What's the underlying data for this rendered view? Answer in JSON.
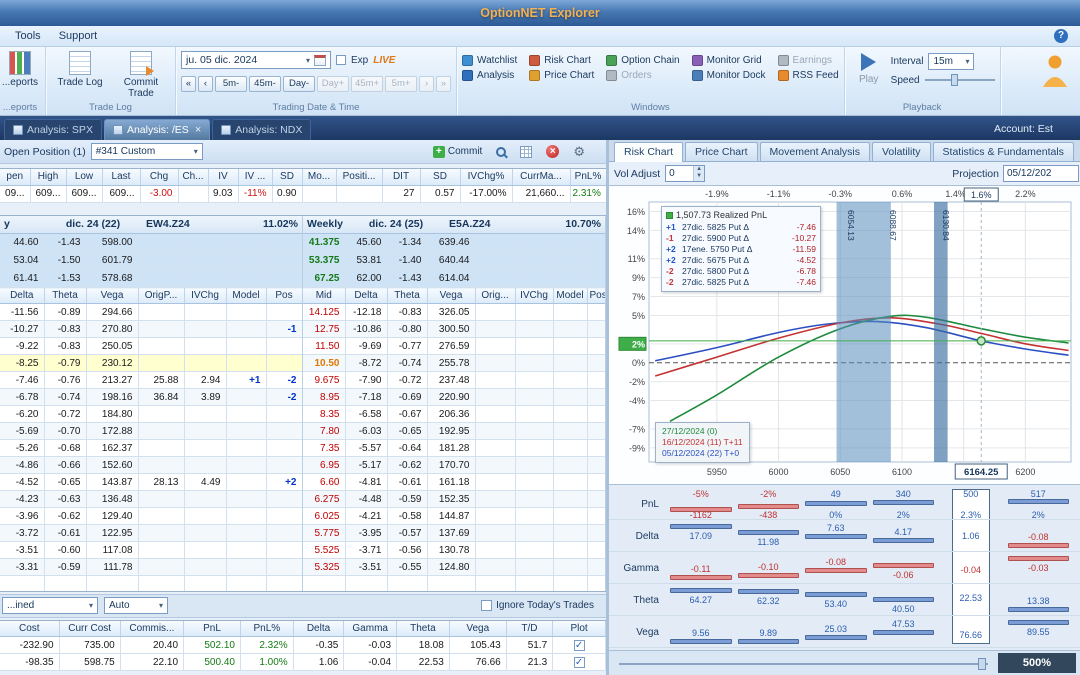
{
  "title": "OptionNET Explorer",
  "menu": {
    "tools": "Tools",
    "support": "Support",
    "help": "?"
  },
  "ribbon": {
    "reports": {
      "button": "...eports",
      "group": "...eports"
    },
    "tradelog": {
      "buttons": [
        "Trade Log",
        "Commit Trade"
      ],
      "label": "Trade Log"
    },
    "datetime": {
      "date": "ju. 05 dic. 2024",
      "exp": "Exp",
      "live": "LIVE",
      "back": [
        "5m-",
        "45m-",
        "Day-"
      ],
      "fwd": [
        "Day+",
        "45m+",
        "5m+"
      ],
      "label": "Trading Date & Time"
    },
    "windows": {
      "row1": [
        "Watchlist",
        "Risk Chart",
        "Option Chain",
        "Monitor Grid",
        "Earnings"
      ],
      "row2": [
        "Analysis",
        "Price Chart",
        "Orders",
        "Monitor Dock",
        "RSS Feed"
      ],
      "disabled": [
        "Earnings",
        "Orders"
      ],
      "label": "Windows"
    },
    "playback": {
      "play": "Play",
      "interval": "Interval",
      "interval_value": "15m",
      "speed": "Speed",
      "label": "Playback"
    }
  },
  "tabs": {
    "items": [
      "Analysis: SPX",
      "Analysis: /ES",
      "Analysis: NDX"
    ],
    "active": 1,
    "account": "Account: Est"
  },
  "position": {
    "label": "Open Position (1)",
    "selector": "#341 Custom",
    "commit": "Commit"
  },
  "quote": {
    "headers": [
      "pen",
      "High",
      "Low",
      "Last",
      "Chg",
      "Ch...",
      "IV",
      "IV ...",
      "SD",
      "Mo...",
      "Positi...",
      "DIT",
      "SD",
      "IVChg%",
      "CurrMa...",
      "PnL%"
    ],
    "values": [
      "09...",
      "609...",
      "609...",
      "609...",
      "-3.00",
      "",
      "9.03",
      "-11%",
      "0.90",
      "",
      "",
      "27",
      "0.57",
      "-17.00%",
      "21,660...",
      "2.31%"
    ]
  },
  "chains": {
    "left": {
      "title_prefix": "y",
      "expiry": "dic. 24 (22)",
      "code": "EW4.Z24",
      "iv": "11.02%",
      "columns": [
        "Delta",
        "Theta",
        "Vega",
        "OrigP...",
        "IVChg",
        "Model",
        "Pos"
      ],
      "calls": [
        [
          "44.60",
          "-1.43",
          "598.00"
        ],
        [
          "53.04",
          "-1.50",
          "601.79"
        ],
        [
          "61.41",
          "-1.53",
          "578.68"
        ]
      ],
      "puts": [
        [
          "-11.56",
          "-0.89",
          "294.66",
          "",
          "",
          "",
          ""
        ],
        [
          "-10.27",
          "-0.83",
          "270.80",
          "",
          "",
          "",
          "-1"
        ],
        [
          "-9.22",
          "-0.83",
          "250.05",
          "",
          "",
          "",
          ""
        ],
        [
          "-8.25",
          "-0.79",
          "230.12",
          "",
          "",
          "",
          ""
        ],
        [
          "-7.46",
          "-0.76",
          "213.27",
          "25.88",
          "2.94",
          "+1",
          "-2"
        ],
        [
          "-6.78",
          "-0.74",
          "198.16",
          "36.84",
          "3.89",
          "",
          "-2"
        ],
        [
          "-6.20",
          "-0.72",
          "184.80",
          "",
          "",
          "",
          ""
        ],
        [
          "-5.69",
          "-0.70",
          "172.88",
          "",
          "",
          "",
          ""
        ],
        [
          "-5.26",
          "-0.68",
          "162.37",
          "",
          "",
          "",
          ""
        ],
        [
          "-4.86",
          "-0.66",
          "152.60",
          "",
          "",
          "",
          ""
        ],
        [
          "-4.52",
          "-0.65",
          "143.87",
          "28.13",
          "4.49",
          "",
          "+2"
        ],
        [
          "-4.23",
          "-0.63",
          "136.48",
          "",
          "",
          "",
          ""
        ],
        [
          "-3.96",
          "-0.62",
          "129.40",
          "",
          "",
          "",
          ""
        ],
        [
          "-3.72",
          "-0.61",
          "122.95",
          "",
          "",
          "",
          ""
        ],
        [
          "-3.51",
          "-0.60",
          "117.08",
          "",
          "",
          "",
          ""
        ],
        [
          "-3.31",
          "-0.59",
          "111.78",
          "",
          "",
          "",
          ""
        ],
        [
          "",
          "",
          "",
          "",
          "",
          "",
          ""
        ]
      ]
    },
    "right": {
      "title_prefix": "Weekly",
      "expiry": "dic. 24 (25)",
      "code": "E5A.Z24",
      "iv": "10.70%",
      "columns": [
        "Mid",
        "Delta",
        "Theta",
        "Vega",
        "Orig...",
        "IVChg",
        "Model",
        "Pos"
      ],
      "calls": [
        [
          "41.375",
          "45.60",
          "-1.34",
          "639.46"
        ],
        [
          "53.375",
          "53.81",
          "-1.40",
          "640.44"
        ],
        [
          "67.25",
          "62.00",
          "-1.43",
          "614.04"
        ]
      ],
      "puts": [
        [
          "14.125",
          "-12.18",
          "-0.83",
          "326.05"
        ],
        [
          "12.75",
          "-10.86",
          "-0.80",
          "300.50"
        ],
        [
          "11.50",
          "-9.69",
          "-0.77",
          "276.59"
        ],
        [
          "10.50",
          "-8.72",
          "-0.74",
          "255.78"
        ],
        [
          "9.675",
          "-7.90",
          "-0.72",
          "237.48"
        ],
        [
          "8.95",
          "-7.18",
          "-0.69",
          "220.90"
        ],
        [
          "8.35",
          "-6.58",
          "-0.67",
          "206.36"
        ],
        [
          "7.80",
          "-6.03",
          "-0.65",
          "192.95"
        ],
        [
          "7.35",
          "-5.57",
          "-0.64",
          "181.28"
        ],
        [
          "6.95",
          "-5.17",
          "-0.62",
          "170.70"
        ],
        [
          "6.60",
          "-4.81",
          "-0.61",
          "161.18"
        ],
        [
          "6.275",
          "-4.48",
          "-0.59",
          "152.35"
        ],
        [
          "6.025",
          "-4.21",
          "-0.58",
          "144.87"
        ],
        [
          "5.775",
          "-3.95",
          "-0.57",
          "137.69"
        ],
        [
          "5.525",
          "-3.71",
          "-0.56",
          "130.78"
        ],
        [
          "5.325",
          "-3.51",
          "-0.55",
          "124.80"
        ],
        [
          "",
          "",
          "",
          ""
        ]
      ]
    }
  },
  "footer": {
    "combo1": "...ined",
    "combo2": "Auto",
    "ignore": "Ignore Today's Trades",
    "headers": [
      "Cost",
      "Curr Cost",
      "Commis...",
      "PnL",
      "PnL%",
      "Delta",
      "Gamma",
      "Theta",
      "Vega",
      "T/D",
      "Plot"
    ],
    "rows": [
      {
        "cells": [
          "-232.90",
          "735.00",
          "20.40",
          "502.10",
          "2.32%",
          "-0.35",
          "-0.03",
          "18.08",
          "105.43",
          "51.7"
        ],
        "plot": true
      },
      {
        "cells": [
          "-98.35",
          "598.75",
          "22.10",
          "500.40",
          "1.00%",
          "1.06",
          "-0.04",
          "22.53",
          "76.66",
          "21.3"
        ],
        "plot": true
      }
    ]
  },
  "risk": {
    "tabs": [
      "Risk Chart",
      "Price Chart",
      "Movement Analysis",
      "Volatility",
      "Statistics & Fundamentals"
    ],
    "active_tab": 0,
    "vol_adjust": "Vol Adjust",
    "vol_value": "0",
    "projection": "Projection",
    "projection_value": "05/12/202",
    "zoom": "500%",
    "chart_data": {
      "type": "line",
      "x_range": [
        5895,
        6237
      ],
      "y_range": [
        -10.5,
        17
      ],
      "x_ticks": [
        5950,
        6000,
        6050,
        6100,
        6150,
        6200
      ],
      "x_tick_labels": [
        "5950",
        "6000",
        "6050",
        "6100",
        "",
        "6200"
      ],
      "top_labels": [
        "-1.9%",
        "-1.1%",
        "-0.3%",
        "0.6%",
        "1.4%",
        "2.2%"
      ],
      "top_boxed": {
        "x": 6164.25,
        "label": "1.6%"
      },
      "y_ticks": [
        "16%",
        "14%",
        "11%",
        "9%",
        "7%",
        "5%",
        "2%",
        "0%",
        "-2%",
        "-4%",
        "-7%",
        "-9%"
      ],
      "y_tick_values": [
        16,
        14,
        11,
        9,
        7,
        5,
        2,
        0,
        -2,
        -4,
        -7,
        -9
      ],
      "y_highlight": "2%",
      "x_boxed": {
        "x": 6164.25,
        "label": "6164.25"
      },
      "bands": [
        {
          "from": 6047,
          "to": 6091
        },
        {
          "from": 6126,
          "to": 6137
        }
      ],
      "band_labels": [
        {
          "x": 6054,
          "label": "6054.13"
        },
        {
          "x": 6088,
          "label": "6088.67"
        },
        {
          "x": 6131,
          "label": "6130.84"
        }
      ],
      "marker": {
        "x": 6164.25,
        "y": 2.31
      },
      "series": [
        {
          "name": "05/12/2024 (22) T+0",
          "color": "#2b4fc2",
          "points": [
            [
              5900,
              0.2
            ],
            [
              5950,
              1.6
            ],
            [
              6000,
              3.2
            ],
            [
              6040,
              4.1
            ],
            [
              6080,
              4.35
            ],
            [
              6120,
              3.7
            ],
            [
              6164.25,
              2.31
            ],
            [
              6200,
              1.45
            ],
            [
              6235,
              0.8
            ]
          ]
        },
        {
          "name": "16/12/2024 (11) T+11",
          "color": "#c43333",
          "points": [
            [
              5900,
              -1.4
            ],
            [
              5950,
              0.6
            ],
            [
              6000,
              2.6
            ],
            [
              6050,
              4.2
            ],
            [
              6090,
              4.75
            ],
            [
              6130,
              4.1
            ],
            [
              6164.25,
              3.1
            ],
            [
              6200,
              2.0
            ],
            [
              6235,
              1.3
            ]
          ]
        },
        {
          "name": "27/12/2024 (0)",
          "color": "#1e8a3e",
          "points": [
            [
              5912,
              -6.2
            ],
            [
              5950,
              -3.4
            ],
            [
              6000,
              0.6
            ],
            [
              6050,
              3.6
            ],
            [
              6090,
              4.9
            ],
            [
              6120,
              4.8
            ],
            [
              6164.25,
              3.6
            ],
            [
              6200,
              2.7
            ],
            [
              6235,
              2.1
            ]
          ]
        }
      ],
      "legend": {
        "title": "1,507.73 Realized PnL",
        "entries": [
          {
            "qty": "+1",
            "desc": "27dic. 5825 Put Δ",
            "delta": "-7.46"
          },
          {
            "qty": "-1",
            "desc": "27dic. 5900 Put Δ",
            "delta": "-10.27"
          },
          {
            "qty": "+2",
            "desc": "17ene. 5750 Put Δ",
            "delta": "-11.59"
          },
          {
            "qty": "+2",
            "desc": "27dic. 5675 Put Δ",
            "delta": "-4.52"
          },
          {
            "qty": "-2",
            "desc": "27dic. 5800 Put Δ",
            "delta": "-6.78"
          },
          {
            "qty": "-2",
            "desc": "27dic. 5825 Put Δ",
            "delta": "-7.46"
          }
        ]
      },
      "info_box": [
        {
          "text": "27/12/2024 (0)",
          "color": "#1e8a3e"
        },
        {
          "text": "16/12/2024 (11) T+11",
          "color": "#c43333"
        },
        {
          "text": "05/12/2024 (22) T+0",
          "color": "#2b4fc2"
        }
      ]
    },
    "ladder": {
      "boxed_col": 4,
      "rows": [
        {
          "label": "PnL",
          "type": "pnl",
          "cells": [
            {
              "top": "-5%",
              "bottom": "-1162",
              "v": -1162
            },
            {
              "top": "-2%",
              "bottom": "-438",
              "v": -438
            },
            {
              "top": "49",
              "bottom": "0%",
              "v": 49
            },
            {
              "top": "340",
              "bottom": "2%",
              "v": 340
            },
            {
              "top": "500",
              "bottom": "2.3%",
              "v": 500
            },
            {
              "top": "517",
              "bottom": "2%",
              "v": 517
            }
          ]
        },
        {
          "label": "Delta",
          "values": [
            "17.09",
            "11.98",
            "7.63",
            "4.17",
            "1.06",
            "-0.08"
          ],
          "nums": [
            17.09,
            11.98,
            7.63,
            4.17,
            1.06,
            -0.08
          ]
        },
        {
          "label": "Gamma",
          "values": [
            "-0.11",
            "-0.10",
            "-0.08",
            "-0.06",
            "-0.04",
            "-0.03"
          ],
          "nums": [
            -0.11,
            -0.1,
            -0.08,
            -0.06,
            -0.04,
            -0.03
          ]
        },
        {
          "label": "Theta",
          "values": [
            "64.27",
            "62.32",
            "53.40",
            "40.50",
            "22.53",
            "13.38"
          ],
          "nums": [
            64.27,
            62.32,
            53.4,
            40.5,
            22.53,
            13.38
          ]
        },
        {
          "label": "Vega",
          "values": [
            "9.56",
            "9.89",
            "25.03",
            "47.53",
            "76.66",
            "89.55"
          ],
          "nums": [
            9.56,
            9.89,
            25.03,
            47.53,
            76.66,
            89.55
          ]
        }
      ]
    }
  }
}
